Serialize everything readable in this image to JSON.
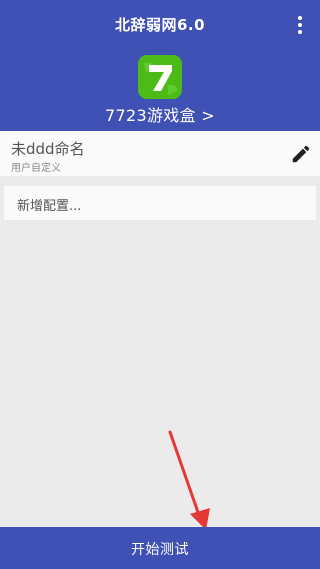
{
  "header": {
    "title": "北辞弱网6.0",
    "menu_icon": "more-vert-icon",
    "background_color": "#3f51b5"
  },
  "target_app": {
    "icon": "7723-app-icon",
    "icon_color": "#4cbb17",
    "name": "7723游戏盒 >"
  },
  "config": {
    "name": "未ddd命名",
    "type": "用户自定义",
    "edit_icon": "pencil-icon"
  },
  "add_config": {
    "label": "新增配置..."
  },
  "annotation": {
    "icon": "red-arrow-annotation",
    "color": "#e53935"
  },
  "start_button": {
    "label": "开始测试",
    "background_color": "#3f51b5"
  }
}
